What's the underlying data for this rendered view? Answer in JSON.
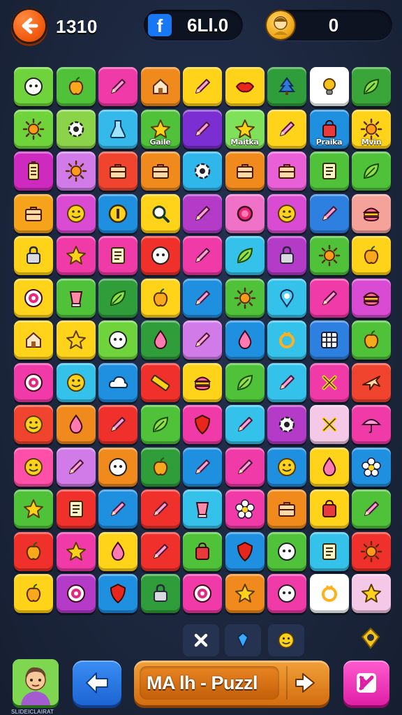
{
  "header": {
    "back_icon": "arrow-left-icon",
    "score": "1310",
    "social_icon": "facebook-icon",
    "social_value": "6Ll.0",
    "coin_icon": "coin-face-icon",
    "coin_value": "0"
  },
  "board": {
    "columns": 9,
    "rows": 13,
    "tiles": [
      {
        "bg": "#6fd43b",
        "icon": "face-icon"
      },
      {
        "bg": "#4fc23a",
        "icon": "apple-icon"
      },
      {
        "bg": "#f03aa8",
        "icon": "pencil-icon"
      },
      {
        "bg": "#f08a1c",
        "icon": "house-icon"
      },
      {
        "bg": "#ffd319",
        "icon": "pencil-icon"
      },
      {
        "bg": "#ffd319",
        "icon": "lips-icon"
      },
      {
        "bg": "#2e9d3a",
        "icon": "tree-icon"
      },
      {
        "bg": "#ffffff",
        "icon": "bulb-icon"
      },
      {
        "bg": "#3aa63a",
        "icon": "leaf-icon"
      },
      {
        "bg": "#6fd43b",
        "icon": "sun-icon"
      },
      {
        "bg": "#8bd44a",
        "icon": "gear-icon"
      },
      {
        "bg": "#35b8ea",
        "icon": "flask-icon"
      },
      {
        "bg": "#4fc23a",
        "icon": "star-icon",
        "label": "Gaile"
      },
      {
        "bg": "#7b2ed2",
        "icon": "pencil-icon"
      },
      {
        "bg": "#7fe05a",
        "icon": "star-icon",
        "label": "Maitka"
      },
      {
        "bg": "#ffd319",
        "icon": "pencil-icon"
      },
      {
        "bg": "#1f8fe0",
        "icon": "bag-icon",
        "label": "Praika"
      },
      {
        "bg": "#ffd319",
        "icon": "sun-icon",
        "label": "Mvin"
      },
      {
        "bg": "#cf2ac0",
        "icon": "battery-icon"
      },
      {
        "bg": "#d17be8",
        "icon": "sun-icon"
      },
      {
        "bg": "#f0442e",
        "icon": "case-icon"
      },
      {
        "bg": "#f08a1c",
        "icon": "case-icon"
      },
      {
        "bg": "#2fb6ea",
        "icon": "gear-icon"
      },
      {
        "bg": "#f08a1c",
        "icon": "case-icon"
      },
      {
        "bg": "#e85fd6",
        "icon": "case-icon"
      },
      {
        "bg": "#4fc23a",
        "icon": "note-icon"
      },
      {
        "bg": "#4fc23a",
        "icon": "leaf-icon"
      },
      {
        "bg": "#f6a31c",
        "icon": "case-icon"
      },
      {
        "bg": "#d94bd2",
        "icon": "smile-icon"
      },
      {
        "bg": "#1f8fe0",
        "icon": "coin-icon"
      },
      {
        "bg": "#ffd319",
        "icon": "search-icon"
      },
      {
        "bg": "#b43ac8",
        "icon": "pencil-icon"
      },
      {
        "bg": "#f072c8",
        "icon": "circle-icon"
      },
      {
        "bg": "#d94bd2",
        "icon": "smile-icon"
      },
      {
        "bg": "#2d7fe0",
        "icon": "pencil-icon"
      },
      {
        "bg": "#f5a29a",
        "icon": "burger-icon"
      },
      {
        "bg": "#ffd319",
        "icon": "lock-icon"
      },
      {
        "bg": "#f03aa8",
        "icon": "star-icon"
      },
      {
        "bg": "#f03aa8",
        "icon": "note-icon"
      },
      {
        "bg": "#f0302a",
        "icon": "face-icon"
      },
      {
        "bg": "#f03aa8",
        "icon": "pencil-icon"
      },
      {
        "bg": "#35c2ea",
        "icon": "leaf-icon"
      },
      {
        "bg": "#b43ac8",
        "icon": "lock-icon"
      },
      {
        "bg": "#4fc23a",
        "icon": "sun-icon"
      },
      {
        "bg": "#ffd319",
        "icon": "apple-icon"
      },
      {
        "bg": "#ffd319",
        "icon": "target-icon"
      },
      {
        "bg": "#4fc23a",
        "icon": "cup-icon"
      },
      {
        "bg": "#2e9d3a",
        "icon": "leaf-icon"
      },
      {
        "bg": "#ffd319",
        "icon": "apple-icon"
      },
      {
        "bg": "#1f8fe0",
        "icon": "pencil-icon"
      },
      {
        "bg": "#4fc23a",
        "icon": "sun-icon"
      },
      {
        "bg": "#35c2ea",
        "icon": "pin-icon"
      },
      {
        "bg": "#f03aa8",
        "icon": "pencil-icon"
      },
      {
        "bg": "#d94bd2",
        "icon": "burger-icon"
      },
      {
        "bg": "#ffd319",
        "icon": "house-icon"
      },
      {
        "bg": "#ffd319",
        "icon": "star-icon"
      },
      {
        "bg": "#6fd43b",
        "icon": "face-icon"
      },
      {
        "bg": "#2e9d3a",
        "icon": "drop-icon"
      },
      {
        "bg": "#d17be8",
        "icon": "pencil-icon"
      },
      {
        "bg": "#1f8fe0",
        "icon": "drop-icon"
      },
      {
        "bg": "#35c2ea",
        "icon": "ring-icon"
      },
      {
        "bg": "#2d7fe0",
        "icon": "grid-icon"
      },
      {
        "bg": "#4fc23a",
        "icon": "apple-icon"
      },
      {
        "bg": "#f03aa8",
        "icon": "target-icon"
      },
      {
        "bg": "#35c2ea",
        "icon": "smile-icon"
      },
      {
        "bg": "#1f8fe0",
        "icon": "cloud-icon"
      },
      {
        "bg": "#f0302a",
        "icon": "ruler-icon"
      },
      {
        "bg": "#ffd319",
        "icon": "burger-icon"
      },
      {
        "bg": "#4fc23a",
        "icon": "leaf-icon"
      },
      {
        "bg": "#35c2ea",
        "icon": "pencil-icon"
      },
      {
        "bg": "#f03aa8",
        "icon": "cross-icon"
      },
      {
        "bg": "#f0442e",
        "icon": "plane-icon"
      },
      {
        "bg": "#f0442e",
        "icon": "smile-icon"
      },
      {
        "bg": "#f08a1c",
        "icon": "drop-icon"
      },
      {
        "bg": "#f0302a",
        "icon": "pencil-icon"
      },
      {
        "bg": "#4fc23a",
        "icon": "leaf-icon"
      },
      {
        "bg": "#f03aa8",
        "icon": "shield-icon"
      },
      {
        "bg": "#35c2ea",
        "icon": "pencil-icon"
      },
      {
        "bg": "#b43ac8",
        "icon": "gear-icon"
      },
      {
        "bg": "#f5c8e8",
        "icon": "cross-icon"
      },
      {
        "bg": "#f03aa8",
        "icon": "umbrella-icon"
      },
      {
        "bg": "#ff4fa8",
        "icon": "smile-icon"
      },
      {
        "bg": "#d17be8",
        "icon": "pencil-icon"
      },
      {
        "bg": "#f08a1c",
        "icon": "face-icon"
      },
      {
        "bg": "#2e9d3a",
        "icon": "apple-icon"
      },
      {
        "bg": "#1f8fe0",
        "icon": "pencil-icon"
      },
      {
        "bg": "#f03aa8",
        "icon": "pencil-icon"
      },
      {
        "bg": "#1f8fe0",
        "icon": "smile-icon"
      },
      {
        "bg": "#ffd319",
        "icon": "drop-icon"
      },
      {
        "bg": "#1f8fe0",
        "icon": "flower-icon"
      },
      {
        "bg": "#4fc23a",
        "icon": "star-icon"
      },
      {
        "bg": "#f0302a",
        "icon": "note-icon"
      },
      {
        "bg": "#1f8fe0",
        "icon": "pencil-icon"
      },
      {
        "bg": "#f0302a",
        "icon": "pencil-icon"
      },
      {
        "bg": "#35c2ea",
        "icon": "cup-icon"
      },
      {
        "bg": "#f03aa8",
        "icon": "flower-icon"
      },
      {
        "bg": "#f08a1c",
        "icon": "case-icon"
      },
      {
        "bg": "#ffd319",
        "icon": "bag-icon"
      },
      {
        "bg": "#4fc23a",
        "icon": "pencil-icon"
      },
      {
        "bg": "#f0302a",
        "icon": "apple-icon"
      },
      {
        "bg": "#f03aa8",
        "icon": "star-icon"
      },
      {
        "bg": "#ffd319",
        "icon": "drop-icon"
      },
      {
        "bg": "#f0302a",
        "icon": "pencil-icon"
      },
      {
        "bg": "#4fc23a",
        "icon": "bag-icon"
      },
      {
        "bg": "#1f8fe0",
        "icon": "shield-icon"
      },
      {
        "bg": "#4fc23a",
        "icon": "face-icon"
      },
      {
        "bg": "#35c2ea",
        "icon": "note-icon"
      },
      {
        "bg": "#f0302a",
        "icon": "sun-icon"
      },
      {
        "bg": "#ffd319",
        "icon": "apple-icon"
      },
      {
        "bg": "#b43ac8",
        "icon": "target-icon"
      },
      {
        "bg": "#1f8fe0",
        "icon": "shield-icon"
      },
      {
        "bg": "#2e9d3a",
        "icon": "lock-icon"
      },
      {
        "bg": "#f03aa8",
        "icon": "target-icon"
      },
      {
        "bg": "#f08a1c",
        "icon": "star-icon"
      },
      {
        "bg": "#f03aa8",
        "icon": "face-icon"
      },
      {
        "bg": "#ffffff",
        "icon": "ring-icon"
      },
      {
        "bg": "#f5c8e8",
        "icon": "star-icon"
      }
    ]
  },
  "tray": {
    "slots": [
      {
        "icon": "cross-icon"
      },
      {
        "icon": "pin-icon"
      },
      {
        "icon": "smile-icon"
      }
    ],
    "gem_icon": "gem-icon"
  },
  "bottom_bar": {
    "avatar_icon": "character-avatar-icon",
    "avatar_caption": "SLIDEICLAIRAT",
    "back_icon": "arrow-left-icon",
    "title": "MA lh - Puzzl",
    "play_icon": "arrow-right-icon",
    "magic_icon": "magic-wand-icon"
  }
}
